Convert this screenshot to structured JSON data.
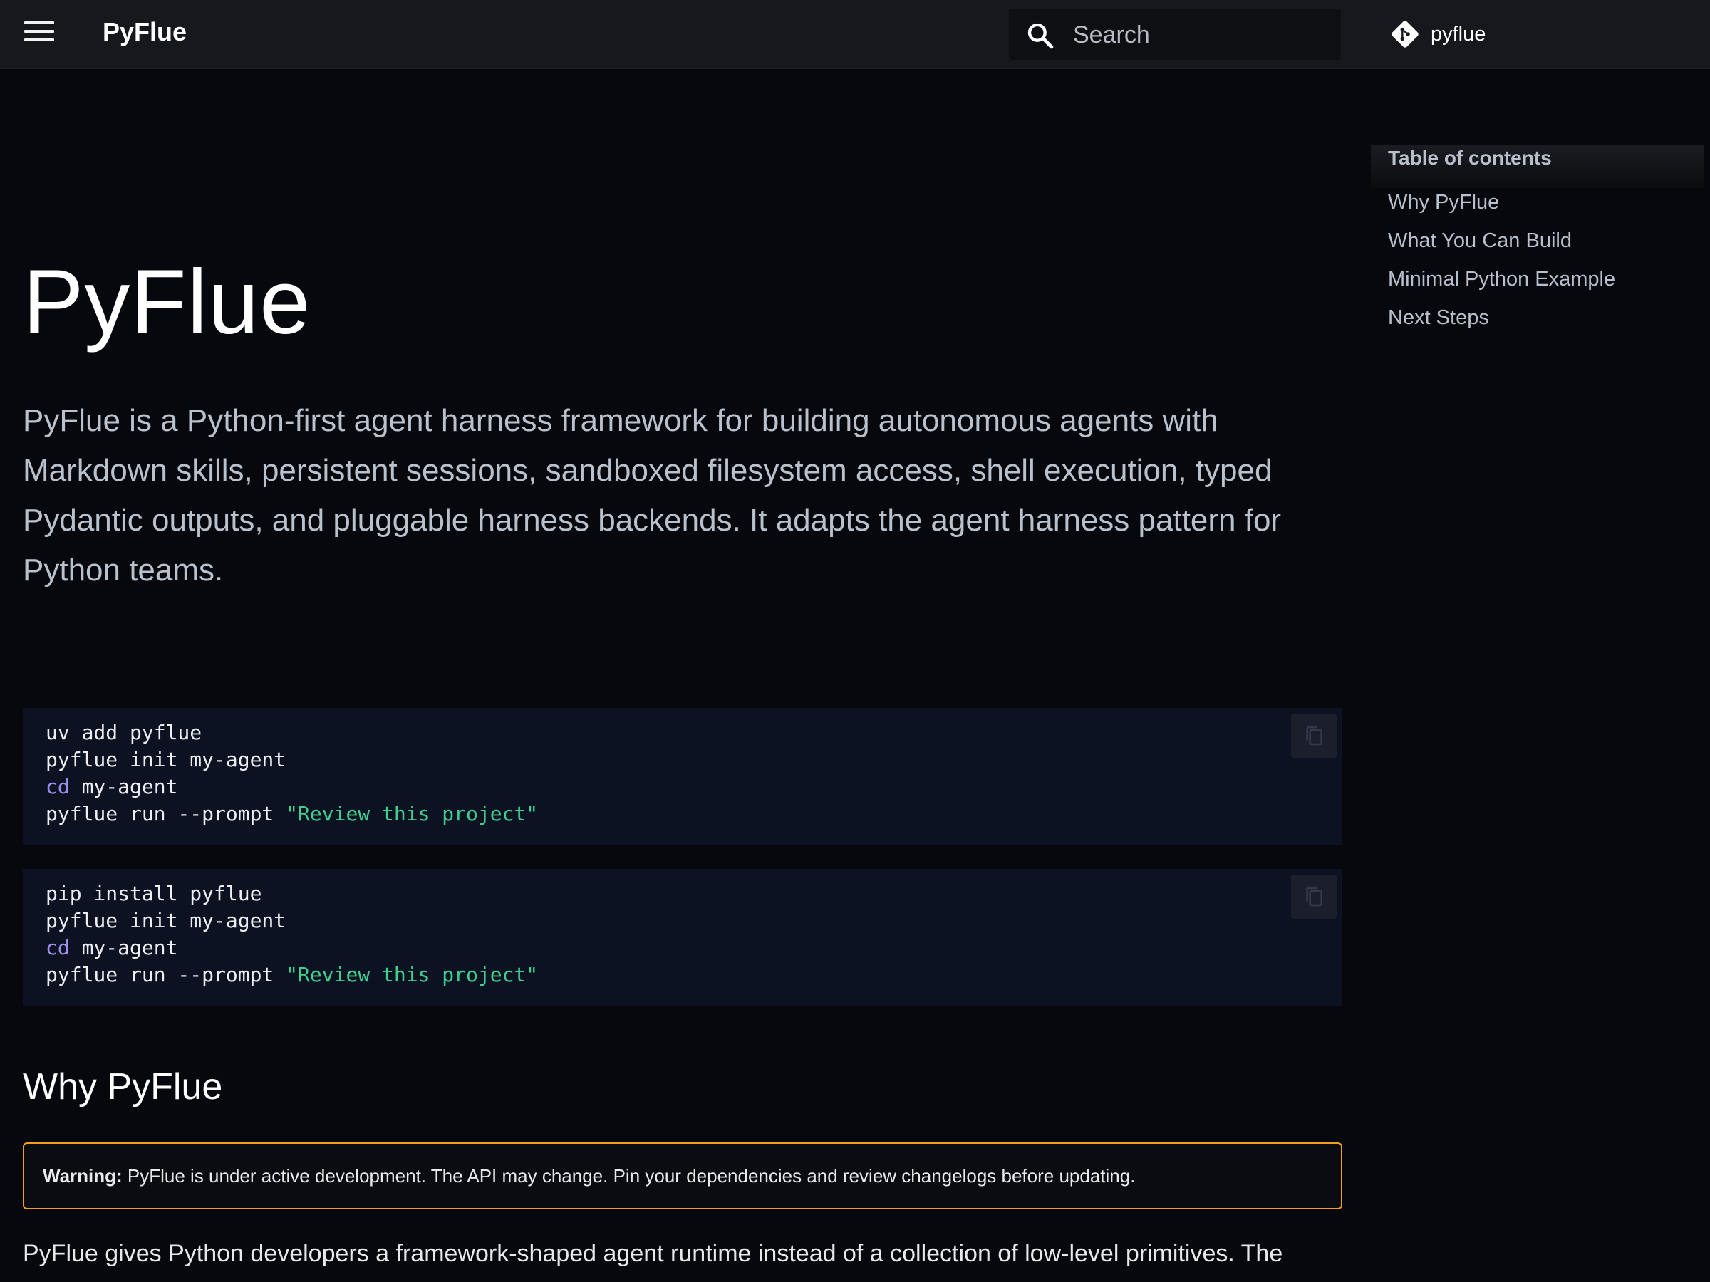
{
  "header": {
    "brand": "PyFlue",
    "search_placeholder": "Search",
    "repo_name": "pyflue"
  },
  "main": {
    "title": "PyFlue",
    "lead": "PyFlue is a Python-first agent harness framework for building autonomous agents with Markdown skills, persistent sessions, sandboxed filesystem access, shell execution, typed Pydantic outputs, and pluggable harness backends. It adapts the agent harness pattern for Python teams.",
    "code_blocks": [
      {
        "lines": [
          {
            "cmd": "uv add pyflue",
            "kw": "",
            "rest": "",
            "str": ""
          },
          {
            "cmd": "pyflue init my-agent",
            "kw": "",
            "rest": "",
            "str": ""
          },
          {
            "cmd": "",
            "kw": "cd",
            "rest": " my-agent",
            "str": ""
          },
          {
            "cmd": "pyflue run --prompt ",
            "kw": "",
            "rest": "",
            "str": "\"Review this project\""
          }
        ]
      },
      {
        "lines": [
          {
            "cmd": "pip install pyflue",
            "kw": "",
            "rest": "",
            "str": ""
          },
          {
            "cmd": "pyflue init my-agent",
            "kw": "",
            "rest": "",
            "str": ""
          },
          {
            "cmd": "",
            "kw": "cd",
            "rest": " my-agent",
            "str": ""
          },
          {
            "cmd": "pyflue run --prompt ",
            "kw": "",
            "rest": "",
            "str": "\"Review this project\""
          }
        ]
      }
    ],
    "section_heading": "Why PyFlue",
    "warning": {
      "label": "Warning:",
      "text": " PyFlue is under active development. The API may change. Pin your dependencies and review changelogs before updating.",
      "border_color": "#f59e1b"
    },
    "paragraph": "PyFlue gives Python developers a framework-shaped agent runtime instead of a collection of low-level primitives. The"
  },
  "toc": {
    "title": "Table of contents",
    "items": [
      "Why PyFlue",
      "What You Can Build",
      "Minimal Python Example",
      "Next Steps"
    ]
  },
  "colors": {
    "background": "#06080e",
    "header": "#17181d",
    "code_bg": "#0c1222",
    "keyword": "#9d8df1",
    "string": "#3fd08e"
  },
  "icons": {
    "menu": "menu-icon",
    "search": "search-icon",
    "repo": "git-icon",
    "copy": "copy-icon"
  }
}
